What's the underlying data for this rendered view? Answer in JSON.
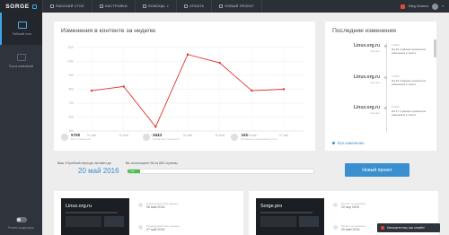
{
  "app": {
    "logo": "SORGE"
  },
  "nav": {
    "items": [
      {
        "label": "РАБОЧИЙ СТОЛ",
        "icon": "desktop-icon"
      },
      {
        "label": "НАСТРОЙКИ",
        "icon": "settings-icon"
      },
      {
        "label": "ПОМОЩЬ",
        "icon": "help-icon",
        "dropdown": true
      },
      {
        "label": "ОПЛАТА",
        "icon": "payment-icon"
      },
      {
        "label": "НОВЫЙ ПРОЕКТ",
        "icon": "new-project-icon"
      }
    ],
    "user_name": "Oleg Gromov"
  },
  "sidebar": {
    "items": [
      {
        "label": "Рабочий стол",
        "icon": "desktop-icon",
        "active": true
      },
      {
        "label": "Поиск изменений",
        "icon": "list-icon",
        "active": false
      }
    ],
    "bottom_label": "Режим модерации"
  },
  "chart_panel": {
    "title": "Изменения в контенте за неделю",
    "stats": [
      {
        "value": "5758",
        "label": "Всего изменений"
      },
      {
        "value": "3413",
        "label": "Добавлено изменений"
      },
      {
        "value": "345",
        "label": "Добавлено информаций текста"
      }
    ]
  },
  "chart_data": {
    "type": "line",
    "x": [
      "01 май",
      "02 май",
      "03 май",
      "04 май",
      "05 май",
      "06 май",
      "07 май"
    ],
    "values": [
      790,
      820,
      530,
      1050,
      990,
      790,
      800
    ],
    "ylim": [
      500,
      1100
    ],
    "yticks": [
      1100,
      1000,
      900,
      800,
      700,
      600,
      500
    ],
    "grid": true,
    "color": "#e0302c"
  },
  "changes_panel": {
    "title": "Последние изменения",
    "items": [
      {
        "site": "Linux.org.ru",
        "sub": "Контакт",
        "date": "5 Май",
        "text": "На 29 странице произошли изменения в тексте"
      },
      {
        "site": "Linux.org.ru",
        "sub": "Контакт",
        "date": "5 Май",
        "text": "На 29 странице произошли изменения в тексте"
      },
      {
        "site": "Linux.org.ru",
        "sub": "Контакт",
        "date": "5 Май",
        "text": "На 27 странице произошли изменения в тексте"
      }
    ],
    "all_link": "Все изменения"
  },
  "trial": {
    "label": "Ваш «Пробный период» активен до",
    "date": "20 май 2016",
    "quota_label": "Вы используете 56 из 800 страниц",
    "progress_percent": 7,
    "progress_text": "7%"
  },
  "new_project_button": "Новый проект",
  "cards": [
    {
      "thumb_title": "Linux.org.ru",
      "rows": [
        {
          "label": "Следующий сбор данных",
          "value": "06 май 2016"
        },
        {
          "label": "Предыдущий сбор данных",
          "value": "07 май 2016"
        }
      ]
    },
    {
      "thumb_title": "Sorge.pro",
      "rows": [
        {
          "label": "Проект остановлен",
          "value": "22 апр 2016"
        },
        {
          "label": "Проект остановлен",
          "value": "20 май 2016"
        }
      ]
    }
  ],
  "toast": {
    "text": "Напишите нам, мы онлайн!"
  }
}
